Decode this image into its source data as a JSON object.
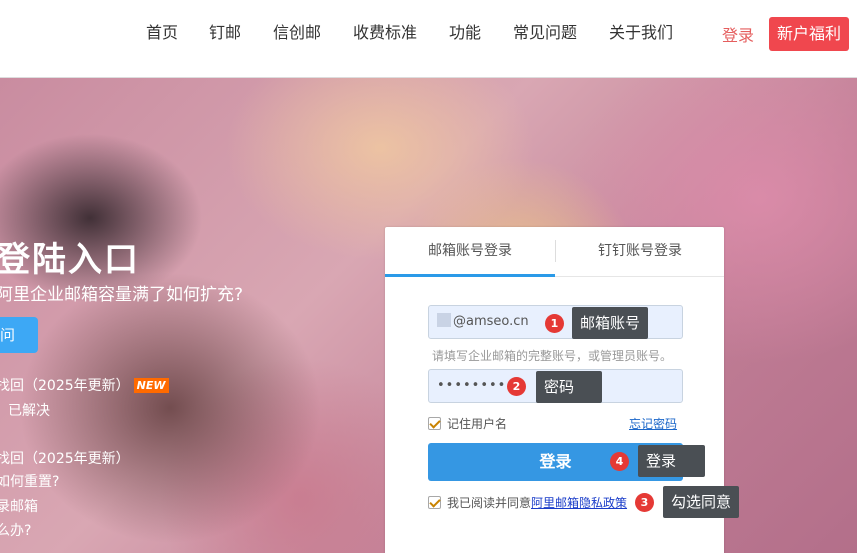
{
  "nav": {
    "items": [
      "首页",
      "钉邮",
      "信创邮",
      "收费标准",
      "功能",
      "常见问题",
      "关于我们"
    ],
    "login": "登录",
    "promo": "新户福利"
  },
  "hero": {
    "title": "登陆入口",
    "subtitle": "阿里企业邮箱容量满了如何扩充?",
    "button": "问",
    "links": [
      "找回（2025年更新）",
      "已解决",
      "找回（2025年更新）",
      "如何重置?",
      "录邮箱",
      "么办?"
    ],
    "new_badge": "NEW"
  },
  "login_panel": {
    "tabs": [
      "邮箱账号登录",
      "钉钉账号登录"
    ],
    "username_value": "@amseo.cn",
    "username_hint": "请填写企业邮箱的完整账号，或管理员账号。",
    "password_value": "••••••••",
    "remember_label": "记住用户名",
    "forgot_link": "忘记密码",
    "login_button": "登录",
    "agree_prefix": "我已阅读并同意",
    "agree_policy": "阿里邮箱隐私政策"
  },
  "annotations": [
    {
      "num": "1",
      "label": "邮箱账号"
    },
    {
      "num": "2",
      "label": "密码"
    },
    {
      "num": "3",
      "label": "勾选同意"
    },
    {
      "num": "4",
      "label": "登录"
    }
  ],
  "colors": {
    "accent": "#3597e3",
    "promo": "#f0474e",
    "login_link": "#e55e5e",
    "annotation": "#e53935"
  }
}
